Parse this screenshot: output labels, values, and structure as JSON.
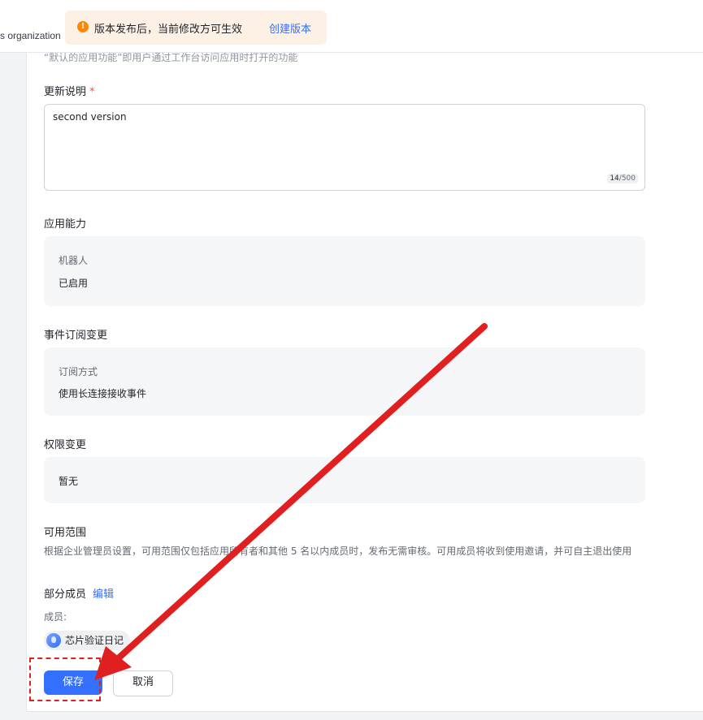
{
  "topbar": {
    "org_text": "s organization",
    "notice_text": "版本发布后，当前修改方可生效",
    "notice_link": "创建版本"
  },
  "faded_line": "“默认的应用功能”即用户通过工作台访问应用时打开的功能",
  "update_notes": {
    "label": "更新说明",
    "required_mark": "*",
    "value": "second version",
    "count_current": "14",
    "count_max": "/500"
  },
  "capability": {
    "title": "应用能力",
    "key": "机器人",
    "value": "已启用"
  },
  "event_sub": {
    "title": "事件订阅变更",
    "key": "订阅方式",
    "value": "使用长连接接收事件"
  },
  "permissions": {
    "title": "权限变更",
    "value": "暂无"
  },
  "scope": {
    "title": "可用范围",
    "description": "根据企业管理员设置，可用范围仅包括应用所有者和其他 5 名以内成员时，发布无需审核。可用成员将收到使用邀请，并可自主退出使用",
    "mode": "部分成员",
    "edit_label": "编辑",
    "members_label": "成员:",
    "member_name": "芯片验证日记"
  },
  "actions": {
    "save_label": "保存",
    "cancel_label": "取消"
  },
  "colors": {
    "accent": "#3370ff",
    "annotation": "#e02020",
    "warning": "#ff8800"
  },
  "icons": {
    "notice": "warning-circle-icon",
    "member": "avatar-icon"
  }
}
